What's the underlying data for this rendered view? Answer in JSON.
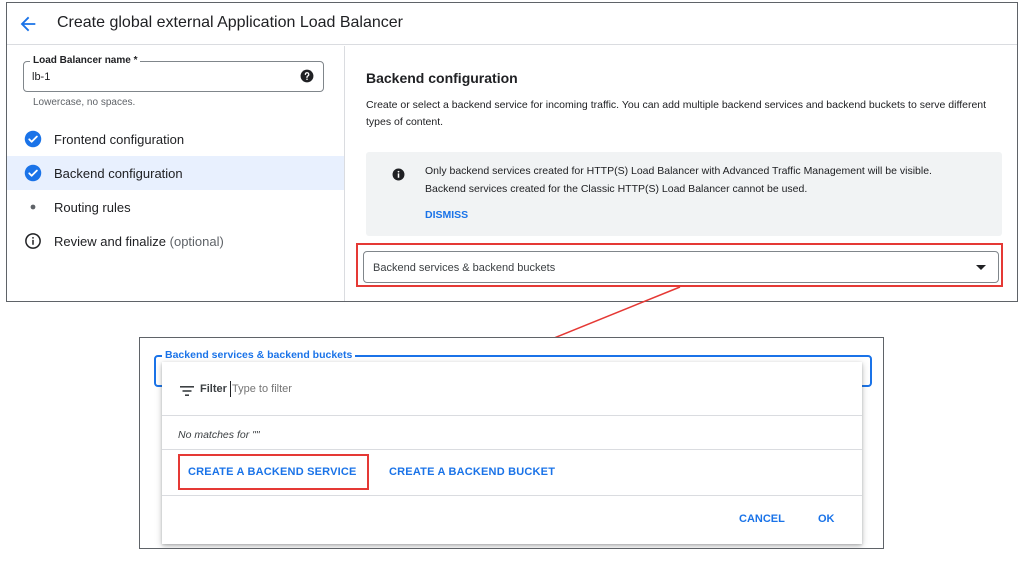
{
  "header": {
    "title": "Create global external Application Load Balancer"
  },
  "lb_name": {
    "label": "Load Balancer name *",
    "value": "lb-1",
    "hint": "Lowercase, no spaces."
  },
  "steps": [
    {
      "label": "Frontend configuration",
      "status": "complete"
    },
    {
      "label": "Backend configuration",
      "status": "complete"
    },
    {
      "label": "Routing rules",
      "status": "pending"
    },
    {
      "label": "Review and finalize",
      "optional": "(optional)",
      "status": "info"
    }
  ],
  "backend": {
    "title": "Backend configuration",
    "description": "Create or select a backend service for incoming traffic. You can add multiple backend services and backend buckets to serve different types of content.",
    "notice_line1": "Only backend services created for HTTP(S) Load Balancer with Advanced Traffic Management will be visible.",
    "notice_line2": "Backend services created for the Classic HTTP(S) Load Balancer cannot be used.",
    "dismiss": "DISMISS",
    "select_placeholder": "Backend services & backend buckets"
  },
  "dropdown": {
    "field_label": "Backend services & backend buckets",
    "filter_label": "Filter",
    "filter_placeholder": "Type to filter",
    "no_matches": "No matches for \"\"",
    "create_service": "CREATE A BACKEND SERVICE",
    "create_bucket": "CREATE A BACKEND BUCKET",
    "cancel": "CANCEL",
    "ok": "OK"
  },
  "colors": {
    "accent": "#1a73e8",
    "highlight": "#e53935",
    "active_step_bg": "#e8f0fe",
    "notice_bg": "#f1f3f4"
  },
  "icons": {
    "back": "arrow-back-icon",
    "help": "help-circle-icon",
    "step_complete": "check-circle-icon",
    "step_pending": "dot-icon",
    "step_info": "info-outline-icon",
    "notice": "info-filled-icon",
    "filter": "filter-lines-icon",
    "caret": "caret-down-icon"
  }
}
